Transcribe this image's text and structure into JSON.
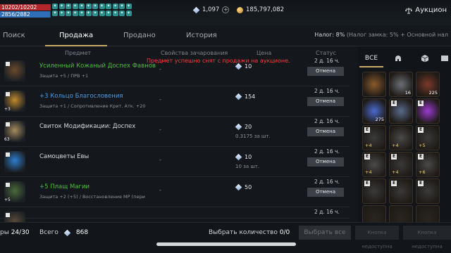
{
  "status": {
    "hp": "10202/10202",
    "mp": "2856/2882",
    "hp_fill": 1.0,
    "mp_fill": 0.991,
    "buff_count": 24
  },
  "currency": {
    "diamonds": "1,097",
    "gold": "185,797,082"
  },
  "window_title": "Аукцион",
  "tabs": [
    "Поиск",
    "Продажа",
    "Продано",
    "История"
  ],
  "active_tab": "Продажа",
  "tax": {
    "label": "Налог: 8%",
    "note": "(Налог замка: 5% + Основной нал"
  },
  "columns": {
    "item": "Предмет",
    "enchant": "Свойства зачарования",
    "price": "Цена",
    "status": "Статус"
  },
  "notice": "Предмет успешно снят с продажи на аукционе.",
  "listings": [
    {
      "name": "Усиленный Кожаный Доспех Фавнов",
      "name_color": "#4fbf3a",
      "sub": "Защита +5 / ПРВ +1",
      "enchant": "-",
      "price": "10",
      "unit": "",
      "status": "2 д. 16 ч.",
      "cancel": "Отмена",
      "icon_color": "#6b4a2c"
    },
    {
      "name": "+3 Кольцо Благословения",
      "name_color": "#4a9be0",
      "sub": "Защита +1 / Сопротивление Крит. Атк. +20",
      "enchant": "-",
      "price": "154",
      "unit": "",
      "status": "2 д. 16 ч.",
      "cancel": "Отмена",
      "icon_color": "#c08a2a",
      "qty": "+3"
    },
    {
      "name": "Свиток Модификации: Доспех",
      "name_color": "#d6d9dc",
      "sub": "",
      "enchant": "-",
      "price": "20",
      "unit": "0.3175 за шт.",
      "status": "2 д. 16 ч.",
      "cancel": "Отмена",
      "icon_color": "#a58a5e",
      "qty": "63"
    },
    {
      "name": "Самоцветы Евы",
      "name_color": "#d6d9dc",
      "sub": "",
      "enchant": "-",
      "price": "10",
      "unit": "10 за шт.",
      "status": "2 д. 16 ч.",
      "cancel": "Отмена",
      "icon_color": "#2c7fd0"
    },
    {
      "name": "+5 Плащ Магии",
      "name_color": "#4fbf3a",
      "sub": "Защита +2 (+5) / Восстановление MP (пери",
      "enchant": "-",
      "price": "50",
      "unit": "",
      "status": "2 д. 16 ч.",
      "cancel": "Отмена",
      "icon_color": "#4a6a3a",
      "qty": "+5"
    },
    {
      "name": "",
      "name_color": "#d6d9dc",
      "sub": "",
      "enchant": "",
      "price": "",
      "unit": "",
      "status": "2 д. 16 ч.",
      "cancel": "",
      "icon_color": "#5a4a3a"
    }
  ],
  "inventory": {
    "tabs": [
      "ВСЕ",
      "helmet-icon",
      "box-icon",
      "scroll-icon"
    ],
    "all_label": "ВСЕ",
    "slots": [
      {
        "color": "#8a5a2a",
        "n": "",
        "p": "",
        "e": false
      },
      {
        "color": "#6a6f75",
        "n": "16",
        "p": "",
        "e": false
      },
      {
        "color": "#7a3a2a",
        "n": "225",
        "p": "",
        "e": false
      },
      {
        "color": "#4a6ad0",
        "n": "275",
        "p": "",
        "e": false
      },
      {
        "color": "#5a6a8a",
        "n": "",
        "p": "",
        "e": true
      },
      {
        "color": "#9a3ad0",
        "n": "",
        "p": "",
        "e": true
      },
      {
        "color": "#3a3a3a",
        "n": "",
        "p": "+4",
        "e": true
      },
      {
        "color": "#4a4a4a",
        "n": "",
        "p": "+4",
        "e": false
      },
      {
        "color": "#3a3a3a",
        "n": "",
        "p": "+5",
        "e": true
      },
      {
        "color": "#4a4a4a",
        "n": "",
        "p": "+4",
        "e": true
      },
      {
        "color": "#3a3a3a",
        "n": "",
        "p": "+4",
        "e": true
      },
      {
        "color": "#4a4a4a",
        "n": "",
        "p": "+6",
        "e": true
      },
      {
        "color": "#3a3a3a",
        "n": "",
        "p": "",
        "e": true
      },
      {
        "color": "#3a3a3a",
        "n": "",
        "p": "",
        "e": true
      },
      {
        "color": "#3a3a3a",
        "n": "",
        "p": "",
        "e": true
      },
      {
        "color": "#2a2520",
        "n": "",
        "p": "",
        "e": false
      },
      {
        "color": "#2a2520",
        "n": "",
        "p": "",
        "e": false
      },
      {
        "color": "#2a2520",
        "n": "",
        "p": "",
        "e": false
      }
    ]
  },
  "bottom": {
    "capacity_prefix": "ры",
    "capacity": "24/30",
    "total_label": "Всего",
    "total_value": "868",
    "select_qty_label": "Выбрать количество",
    "select_qty_value": "0/0",
    "select_all": "Выбрать все",
    "btn2": "Кнопка недоступна",
    "btn3": "Кнопка недоступна"
  }
}
